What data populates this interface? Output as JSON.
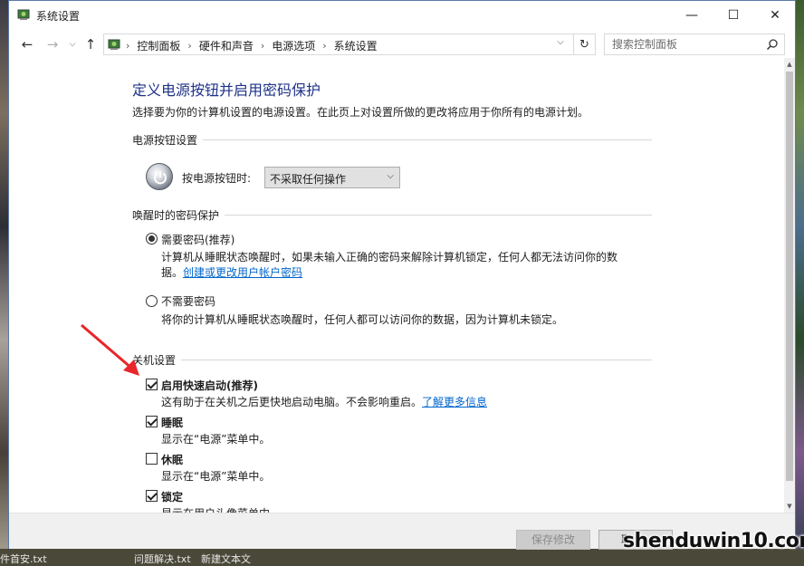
{
  "window": {
    "title": "系统设置",
    "controls": {
      "minimize": "—",
      "maximize": "☐",
      "close": "✕"
    }
  },
  "address_bar": {
    "breadcrumbs": [
      "控制面板",
      "硬件和声音",
      "电源选项",
      "系统设置"
    ],
    "search_placeholder": "搜索控制面板"
  },
  "page": {
    "title": "定义电源按钮并启用密码保护",
    "description": "选择要为你的计算机设置的电源设置。在此页上对设置所做的更改将应用于你所有的电源计划。"
  },
  "power_button_section": {
    "heading": "电源按钮设置",
    "label": "按电源按钮时:",
    "selected_option": "不采取任何操作"
  },
  "wake_password_section": {
    "heading": "唤醒时的密码保护",
    "require": {
      "label": "需要密码(推荐)",
      "checked": true,
      "desc_line1": "计算机从睡眠状态唤醒时，如果未输入正确的密码来解除计算机锁定，任何人都无法访问你的数",
      "desc_line2_prefix": "据。",
      "link": "创建或更改用户帐户密码"
    },
    "no_require": {
      "label": "不需要密码",
      "checked": false,
      "desc": "将你的计算机从睡眠状态唤醒时，任何人都可以访问你的数据，因为计算机未锁定。"
    }
  },
  "shutdown_section": {
    "heading": "关机设置",
    "items": [
      {
        "label": "启用快速启动(推荐)",
        "checked": true,
        "desc": "这有助于在关机之后更快地启动电脑。不会影响重启。",
        "link": "了解更多信息"
      },
      {
        "label": "睡眠",
        "checked": true,
        "desc": "显示在“电源”菜单中。"
      },
      {
        "label": "休眠",
        "checked": false,
        "desc": "显示在“电源”菜单中。"
      },
      {
        "label": "锁定",
        "checked": true,
        "desc": "显示在用户头像菜单中"
      }
    ]
  },
  "footer": {
    "save_label": "保存修改",
    "cancel_label": "取"
  },
  "desktop": {
    "taskbar_texts": [
      "件首安.txt",
      "问题解决.txt",
      "新建文本文"
    ]
  },
  "watermark": "shenduwin10.com",
  "colors": {
    "title_blue": "#1e3287",
    "link_blue": "#0066cc",
    "annotation_red": "#e8262b"
  }
}
